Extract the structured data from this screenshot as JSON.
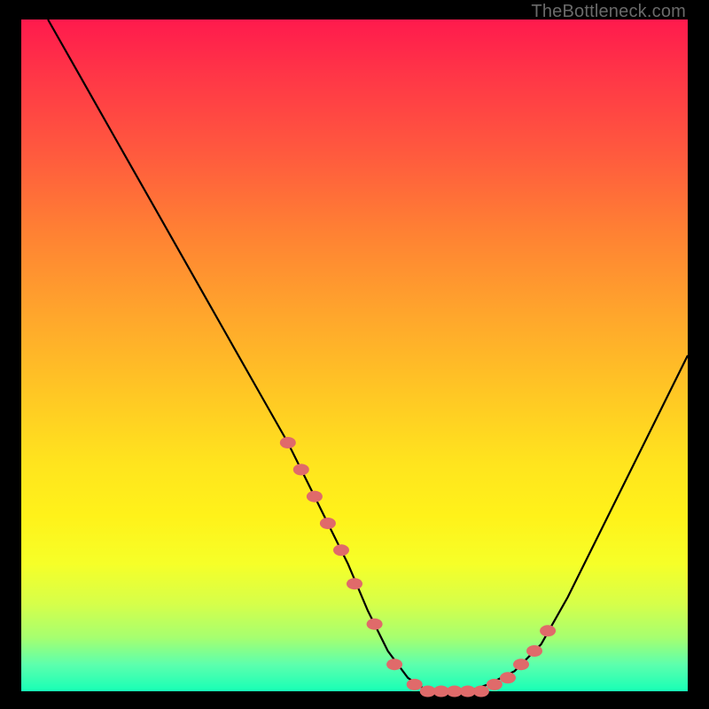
{
  "watermark": "TheBottleneck.com",
  "colors": {
    "background": "#000000",
    "curve": "#000000",
    "marker_fill": "#e06a6a",
    "marker_stroke": "#c85a5a"
  },
  "chart_data": {
    "type": "line",
    "title": "",
    "xlabel": "",
    "ylabel": "",
    "xlim": [
      0,
      100
    ],
    "ylim": [
      0,
      100
    ],
    "series": [
      {
        "name": "bottleneck-curve",
        "x": [
          4,
          8,
          12,
          16,
          20,
          24,
          28,
          32,
          36,
          40,
          43,
          46,
          49,
          52,
          55,
          58,
          61,
          64,
          67,
          70,
          74,
          78,
          82,
          86,
          90,
          94,
          98,
          100
        ],
        "values": [
          100,
          93,
          86,
          79,
          72,
          65,
          58,
          51,
          44,
          37,
          31,
          25,
          19,
          12,
          6,
          2,
          0,
          0,
          0,
          1,
          3,
          7,
          14,
          22,
          30,
          38,
          46,
          50
        ]
      }
    ],
    "markers": {
      "x": [
        40,
        42,
        44,
        46,
        48,
        50,
        53,
        56,
        59,
        61,
        63,
        65,
        67,
        69,
        71,
        73,
        75,
        77,
        79
      ],
      "values": [
        37,
        33,
        29,
        25,
        21,
        16,
        10,
        4,
        1,
        0,
        0,
        0,
        0,
        0,
        1,
        2,
        4,
        6,
        9
      ]
    }
  }
}
